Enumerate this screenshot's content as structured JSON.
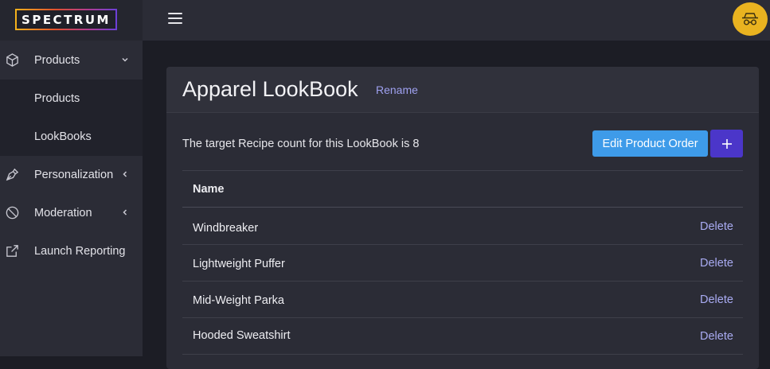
{
  "app": {
    "logo_text": "SPECTRUM"
  },
  "sidebar": {
    "items": [
      {
        "label": "Products",
        "icon": "cube-icon",
        "expanded": true
      },
      {
        "label": "Products",
        "sub": true
      },
      {
        "label": "LookBooks",
        "sub": true
      },
      {
        "label": "Personalization",
        "icon": "pen-nib-icon",
        "expanded": false
      },
      {
        "label": "Moderation",
        "icon": "no-sign-icon",
        "expanded": false
      },
      {
        "label": "Launch Reporting",
        "icon": "external-link-icon"
      }
    ]
  },
  "header": {
    "menu_icon": "hamburger-icon",
    "avatar_icon": "incognito-icon",
    "avatar_color": "#e9b320"
  },
  "main": {
    "title": "Apparel LookBook",
    "rename_label": "Rename",
    "target_text": "The target Recipe count for this LookBook is 8",
    "edit_order_label": "Edit Product Order",
    "add_label": "+",
    "table": {
      "header": "Name",
      "action_label": "Delete",
      "rows": [
        {
          "name": "Windbreaker",
          "action": "Delete"
        },
        {
          "name": "Lightweight Puffer",
          "action": "Delete"
        },
        {
          "name": "Mid-Weight Parka",
          "action": "Delete"
        },
        {
          "name": "Hooded Sweatshirt",
          "action": "Delete"
        }
      ]
    }
  },
  "colors": {
    "accent_blue": "#3e9be9",
    "accent_purple": "#4b36c9",
    "link": "#a9abf2"
  }
}
